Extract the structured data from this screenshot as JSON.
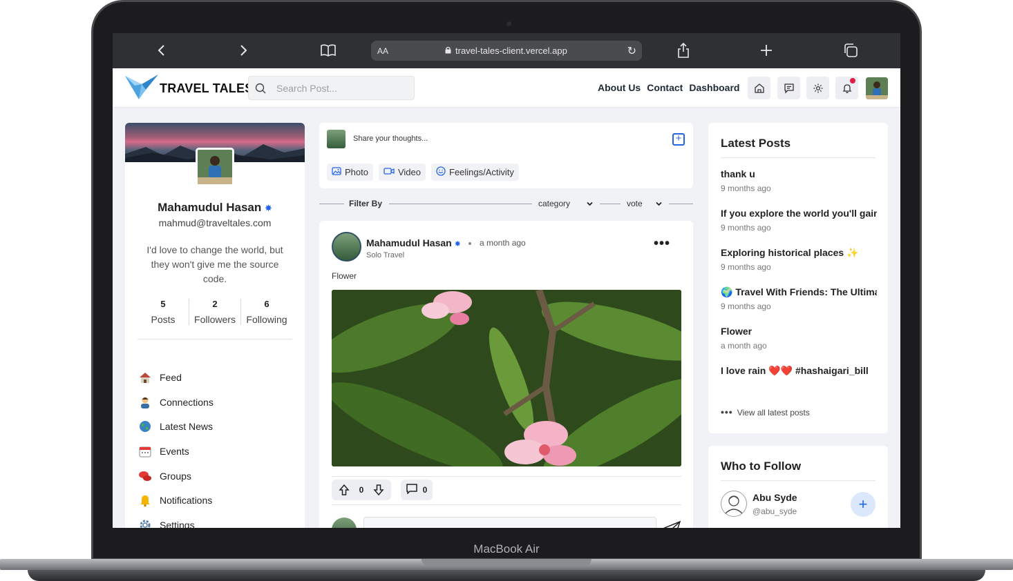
{
  "device": {
    "brand": "MacBook Air"
  },
  "browser": {
    "reader_label": "AA",
    "url": "travel-tales-client.vercel.app"
  },
  "app": {
    "logo_text": "TRAVEL TALES",
    "search_placeholder": "Search Post...",
    "nav": [
      "About Us",
      "Contact",
      "Dashboard"
    ]
  },
  "profile": {
    "name": "Mahamudul Hasan",
    "email": "mahmud@traveltales.com",
    "bio": "I'd love to change the world, but they won't give me the source code.",
    "stats": [
      {
        "value": "5",
        "label": "Posts"
      },
      {
        "value": "2",
        "label": "Followers"
      },
      {
        "value": "6",
        "label": "Following"
      }
    ],
    "menu": [
      {
        "label": "Feed",
        "icon": "house-icon"
      },
      {
        "label": "Connections",
        "icon": "person-icon"
      },
      {
        "label": "Latest News",
        "icon": "globe-icon"
      },
      {
        "label": "Events",
        "icon": "calendar-icon"
      },
      {
        "label": "Groups",
        "icon": "chat-bubbles-icon"
      },
      {
        "label": "Notifications",
        "icon": "bell-icon"
      },
      {
        "label": "Settings",
        "icon": "gear-icon"
      }
    ]
  },
  "composer": {
    "placeholder": "Share your thoughts...",
    "actions": [
      {
        "label": "Photo",
        "icon": "image-icon"
      },
      {
        "label": "Video",
        "icon": "video-icon"
      },
      {
        "label": "Feelings/Activity",
        "icon": "smile-icon"
      }
    ]
  },
  "filter": {
    "label": "Filter By",
    "category": "category",
    "vote": "vote"
  },
  "post": {
    "author": "Mahamudul Hasan",
    "time": "a month ago",
    "category": "Solo Travel",
    "title": "Flower",
    "upvotes": "0",
    "comments": "0"
  },
  "latest_posts": {
    "title": "Latest Posts",
    "items": [
      {
        "title": "thank u",
        "date": "9 months ago"
      },
      {
        "title": "If you explore the world you'll gain",
        "date": "9 months ago"
      },
      {
        "title": "Exploring historical places ✨",
        "date": "9 months ago"
      },
      {
        "title": "🌍 Travel With Friends: The Ultimate",
        "date": "9 months ago"
      },
      {
        "title": "Flower",
        "date": "a month ago"
      },
      {
        "title": "I love rain ❤️❤️ #hashaigari_bill",
        "date": ""
      }
    ],
    "view_all": "View all latest posts"
  },
  "who_to_follow": {
    "title": "Who to Follow",
    "users": [
      {
        "name": "Abu Syde",
        "handle": "@abu_syde"
      }
    ]
  },
  "colors": {
    "accent": "#2563eb",
    "notification": "#e11d48"
  }
}
